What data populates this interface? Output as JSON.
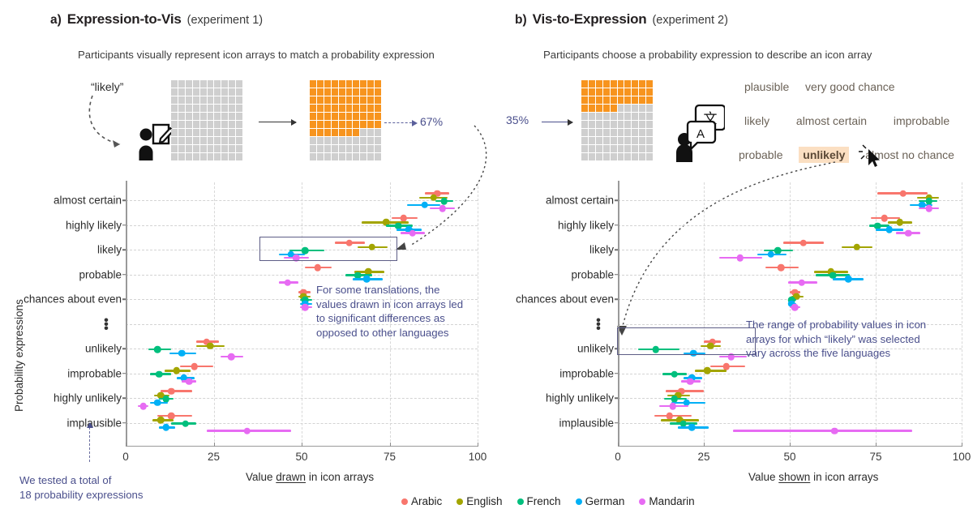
{
  "panels": [
    {
      "letter": "a)",
      "title": "Expression-to-Vis",
      "experiment": "(experiment 1)",
      "subtitle": "Participants visually represent icon arrays to match a probability expression",
      "stimulus_label": "“likely”",
      "result_value": "67%",
      "xaxis_title_pre": "Value ",
      "xaxis_title_u": "drawn",
      "xaxis_title_post": " in icon arrays",
      "annotation": "For some translations, the\nvalues drawn in icon arrays led\nto significant differences as\nopposed to other languages"
    },
    {
      "letter": "b)",
      "title": "Vis-to-Expression",
      "experiment": "(experiment 2)",
      "subtitle": "Participants choose a probability expression to describe an icon array",
      "stimulus_label": "35%",
      "xaxis_title_pre": "Value ",
      "xaxis_title_u": "shown",
      "xaxis_title_post": " in icon arrays",
      "annotation": "The range of probability values in icon\narrays for which “likely” was selected\nvary across the five languages",
      "word_rows": [
        [
          "plausible",
          "very good chance"
        ],
        [
          "likely",
          "almost certain",
          "improbable"
        ],
        [
          "probable",
          "unlikely",
          "almost no chance"
        ]
      ],
      "highlighted_word": "unlikely"
    }
  ],
  "note_left": "We tested a total of\n18 probability expressions",
  "yaxis_title": "Probability expressions",
  "categories": [
    "almost certain",
    "highly likely",
    "likely",
    "probable",
    "chances about even",
    "⋮",
    "unlikely",
    "improbable",
    "highly unlikely",
    "implausible"
  ],
  "legend": {
    "entries": [
      {
        "label": "Arabic",
        "color": "#F8766D"
      },
      {
        "label": "English",
        "color": "#A3A500"
      },
      {
        "label": "French",
        "color": "#00BF7D"
      },
      {
        "label": "German",
        "color": "#00B0F6"
      },
      {
        "label": "Mandarin",
        "color": "#E76BF3"
      }
    ]
  },
  "icon_arrays": {
    "panel_a_empty_filled": 0,
    "panel_a_result_filled": 67,
    "panel_b_filled": 35,
    "grid_cols": 10,
    "grid_rows": 10,
    "fill_color": "#F7941E",
    "empty_color": "#cfcfcf"
  },
  "chart_data": [
    {
      "id": "experiment-1",
      "type": "scatter",
      "title": "Expression-to-Vis (experiment 1)",
      "xlabel": "Value drawn in icon arrays",
      "ylabel": "Probability expressions",
      "xlim": [
        0,
        100
      ],
      "xticks": [
        0,
        25,
        50,
        75,
        100
      ],
      "grid": true,
      "legend_position": "bottom-center",
      "categories": [
        "almost certain",
        "highly likely",
        "likely",
        "probable",
        "chances about even",
        "⋮",
        "unlikely",
        "improbable",
        "highly unlikely",
        "implausible"
      ],
      "series": [
        {
          "name": "Arabic",
          "color": "#F8766D",
          "points": [
            {
              "category": "almost certain",
              "value": 88.5,
              "low": 85.0,
              "high": 92.0
            },
            {
              "category": "highly likely",
              "value": 79.0,
              "low": 75.5,
              "high": 83.0
            },
            {
              "category": "likely",
              "value": 63.5,
              "low": 59.5,
              "high": 68.0
            },
            {
              "category": "probable",
              "value": 54.5,
              "low": 51.0,
              "high": 58.5
            },
            {
              "category": "chances about even",
              "value": 50.5,
              "low": 49.0,
              "high": 52.5
            },
            {
              "category": "unlikely",
              "value": 23.0,
              "low": 20.0,
              "high": 26.5
            },
            {
              "category": "improbable",
              "value": 19.5,
              "low": 15.5,
              "high": 25.0
            },
            {
              "category": "highly unlikely",
              "value": 13.0,
              "low": 10.0,
              "high": 19.0
            },
            {
              "category": "implausible",
              "value": 13.0,
              "low": 9.0,
              "high": 19.0
            }
          ]
        },
        {
          "name": "English",
          "color": "#A3A500",
          "points": [
            {
              "category": "almost certain",
              "value": 87.5,
              "low": 83.5,
              "high": 91.5
            },
            {
              "category": "highly likely",
              "value": 74.0,
              "low": 67.0,
              "high": 80.5
            },
            {
              "category": "likely",
              "value": 70.0,
              "low": 66.0,
              "high": 74.5
            },
            {
              "category": "probable",
              "value": 69.0,
              "low": 65.0,
              "high": 73.5
            },
            {
              "category": "chances about even",
              "value": 50.5,
              "low": 49.0,
              "high": 52.5
            },
            {
              "category": "unlikely",
              "value": 24.0,
              "low": 20.0,
              "high": 28.0
            },
            {
              "category": "improbable",
              "value": 14.5,
              "low": 11.0,
              "high": 18.5
            },
            {
              "category": "highly unlikely",
              "value": 10.0,
              "low": 8.0,
              "high": 12.5
            },
            {
              "category": "implausible",
              "value": 10.0,
              "low": 7.5,
              "high": 13.5
            }
          ]
        },
        {
          "name": "French",
          "color": "#00BF7D",
          "points": [
            {
              "category": "almost certain",
              "value": 90.5,
              "low": 88.0,
              "high": 93.0
            },
            {
              "category": "highly likely",
              "value": 77.5,
              "low": 74.0,
              "high": 81.5
            },
            {
              "category": "likely",
              "value": 51.0,
              "low": 46.5,
              "high": 56.5
            },
            {
              "category": "probable",
              "value": 66.0,
              "low": 62.5,
              "high": 70.0
            },
            {
              "category": "chances about even",
              "value": 51.0,
              "low": 49.5,
              "high": 53.0
            },
            {
              "category": "unlikely",
              "value": 9.0,
              "low": 6.5,
              "high": 13.0
            },
            {
              "category": "improbable",
              "value": 9.5,
              "low": 7.0,
              "high": 13.0
            },
            {
              "category": "highly unlikely",
              "value": 11.5,
              "low": 9.5,
              "high": 13.5
            },
            {
              "category": "implausible",
              "value": 17.0,
              "low": 13.0,
              "high": 20.0
            }
          ]
        },
        {
          "name": "German",
          "color": "#00B0F6",
          "points": [
            {
              "category": "almost certain",
              "value": 85.0,
              "low": 80.0,
              "high": 89.5
            },
            {
              "category": "highly likely",
              "value": 80.5,
              "low": 77.0,
              "high": 84.0
            },
            {
              "category": "likely",
              "value": 47.0,
              "low": 43.5,
              "high": 51.0
            },
            {
              "category": "probable",
              "value": 68.5,
              "low": 64.5,
              "high": 73.0
            },
            {
              "category": "chances about even",
              "value": 51.0,
              "low": 49.5,
              "high": 53.0
            },
            {
              "category": "unlikely",
              "value": 16.0,
              "low": 12.5,
              "high": 20.0
            },
            {
              "category": "improbable",
              "value": 16.5,
              "low": 14.5,
              "high": 19.5
            },
            {
              "category": "highly unlikely",
              "value": 9.0,
              "low": 7.0,
              "high": 12.0
            },
            {
              "category": "implausible",
              "value": 11.5,
              "low": 9.5,
              "high": 14.0
            }
          ]
        },
        {
          "name": "Mandarin",
          "color": "#E76BF3",
          "points": [
            {
              "category": "almost certain",
              "value": 90.0,
              "low": 86.5,
              "high": 93.5
            },
            {
              "category": "highly likely",
              "value": 81.5,
              "low": 78.0,
              "high": 85.0
            },
            {
              "category": "likely",
              "value": 48.5,
              "low": 45.0,
              "high": 52.0
            },
            {
              "category": "probable",
              "value": 46.0,
              "low": 43.5,
              "high": 49.0
            },
            {
              "category": "chances about even",
              "value": 51.0,
              "low": 49.5,
              "high": 53.0
            },
            {
              "category": "unlikely",
              "value": 30.0,
              "low": 27.0,
              "high": 33.5
            },
            {
              "category": "improbable",
              "value": 18.0,
              "low": 16.0,
              "high": 20.0
            },
            {
              "category": "highly unlikely",
              "value": 5.0,
              "low": 3.5,
              "high": 6.5
            },
            {
              "category": "implausible",
              "value": 34.5,
              "low": 23.0,
              "high": 47.0
            }
          ]
        }
      ]
    },
    {
      "id": "experiment-2",
      "type": "scatter",
      "title": "Vis-to-Expression (experiment 2)",
      "xlabel": "Value shown in icon arrays",
      "ylabel": "Probability expressions",
      "xlim": [
        0,
        100
      ],
      "xticks": [
        0,
        25,
        50,
        75,
        100
      ],
      "grid": true,
      "legend_position": "bottom-center",
      "categories": [
        "almost certain",
        "highly likely",
        "likely",
        "probable",
        "chances about even",
        "⋮",
        "unlikely",
        "improbable",
        "highly unlikely",
        "implausible"
      ],
      "series": [
        {
          "name": "Arabic",
          "color": "#F8766D",
          "points": [
            {
              "category": "almost certain",
              "value": 83.0,
              "low": 75.5,
              "high": 90.0
            },
            {
              "category": "highly likely",
              "value": 77.5,
              "low": 73.5,
              "high": 82.0
            },
            {
              "category": "likely",
              "value": 54.0,
              "low": 48.0,
              "high": 60.0
            },
            {
              "category": "probable",
              "value": 47.5,
              "low": 43.0,
              "high": 52.5
            },
            {
              "category": "chances about even",
              "value": 51.5,
              "low": 50.0,
              "high": 53.0
            },
            {
              "category": "unlikely",
              "value": 27.5,
              "low": 25.0,
              "high": 30.0
            },
            {
              "category": "improbable",
              "value": 31.5,
              "low": 27.0,
              "high": 37.0
            },
            {
              "category": "highly unlikely",
              "value": 18.5,
              "low": 14.0,
              "high": 25.0
            },
            {
              "category": "implausible",
              "value": 15.0,
              "low": 10.5,
              "high": 21.5
            }
          ]
        },
        {
          "name": "English",
          "color": "#A3A500",
          "points": [
            {
              "category": "almost certain",
              "value": 90.5,
              "low": 87.0,
              "high": 93.5
            },
            {
              "category": "highly likely",
              "value": 82.0,
              "low": 78.5,
              "high": 85.5
            },
            {
              "category": "likely",
              "value": 69.5,
              "low": 65.0,
              "high": 74.0
            },
            {
              "category": "probable",
              "value": 62.0,
              "low": 57.0,
              "high": 67.0
            },
            {
              "category": "chances about even",
              "value": 52.0,
              "low": 50.5,
              "high": 54.0
            },
            {
              "category": "unlikely",
              "value": 27.0,
              "low": 24.0,
              "high": 30.0
            },
            {
              "category": "improbable",
              "value": 26.0,
              "low": 22.5,
              "high": 31.5
            },
            {
              "category": "highly unlikely",
              "value": 17.5,
              "low": 14.5,
              "high": 21.0
            },
            {
              "category": "implausible",
              "value": 18.0,
              "low": 12.5,
              "high": 23.5
            }
          ]
        },
        {
          "name": "French",
          "color": "#00BF7D",
          "points": [
            {
              "category": "almost certain",
              "value": 90.5,
              "low": 87.5,
              "high": 93.0
            },
            {
              "category": "highly likely",
              "value": 75.5,
              "low": 73.0,
              "high": 79.0
            },
            {
              "category": "likely",
              "value": 46.5,
              "low": 42.5,
              "high": 51.0
            },
            {
              "category": "probable",
              "value": 62.5,
              "low": 57.5,
              "high": 67.5
            },
            {
              "category": "chances about even",
              "value": 50.5,
              "low": 49.5,
              "high": 52.0
            },
            {
              "category": "unlikely",
              "value": 11.0,
              "low": 6.0,
              "high": 18.0
            },
            {
              "category": "improbable",
              "value": 16.5,
              "low": 13.0,
              "high": 20.0
            },
            {
              "category": "highly unlikely",
              "value": 16.5,
              "low": 13.5,
              "high": 20.0
            },
            {
              "category": "implausible",
              "value": 19.0,
              "low": 15.0,
              "high": 23.0
            }
          ]
        },
        {
          "name": "German",
          "color": "#00B0F6",
          "points": [
            {
              "category": "almost certain",
              "value": 88.5,
              "low": 85.0,
              "high": 91.5
            },
            {
              "category": "highly likely",
              "value": 79.0,
              "low": 75.0,
              "high": 83.0
            },
            {
              "category": "likely",
              "value": 44.5,
              "low": 40.5,
              "high": 49.0
            },
            {
              "category": "probable",
              "value": 67.0,
              "low": 62.5,
              "high": 71.5
            },
            {
              "category": "chances about even",
              "value": 50.5,
              "low": 49.5,
              "high": 52.0
            },
            {
              "category": "unlikely",
              "value": 22.0,
              "low": 19.0,
              "high": 25.5
            },
            {
              "category": "improbable",
              "value": 21.5,
              "low": 19.0,
              "high": 24.5
            },
            {
              "category": "highly unlikely",
              "value": 20.0,
              "low": 15.5,
              "high": 25.5
            },
            {
              "category": "implausible",
              "value": 21.5,
              "low": 17.5,
              "high": 26.5
            }
          ]
        },
        {
          "name": "Mandarin",
          "color": "#E76BF3",
          "points": [
            {
              "category": "almost certain",
              "value": 90.5,
              "low": 87.5,
              "high": 93.5
            },
            {
              "category": "highly likely",
              "value": 84.5,
              "low": 81.0,
              "high": 88.0
            },
            {
              "category": "likely",
              "value": 35.5,
              "low": 29.5,
              "high": 42.0
            },
            {
              "category": "probable",
              "value": 53.5,
              "low": 49.5,
              "high": 58.0
            },
            {
              "category": "chances about even",
              "value": 51.5,
              "low": 50.0,
              "high": 53.0
            },
            {
              "category": "unlikely",
              "value": 33.0,
              "low": 29.5,
              "high": 37.5
            },
            {
              "category": "improbable",
              "value": 21.0,
              "low": 18.5,
              "high": 24.0
            },
            {
              "category": "highly unlikely",
              "value": 16.0,
              "low": 12.0,
              "high": 20.5
            },
            {
              "category": "implausible",
              "value": 63.0,
              "low": 33.5,
              "high": 85.5
            }
          ]
        }
      ]
    }
  ]
}
